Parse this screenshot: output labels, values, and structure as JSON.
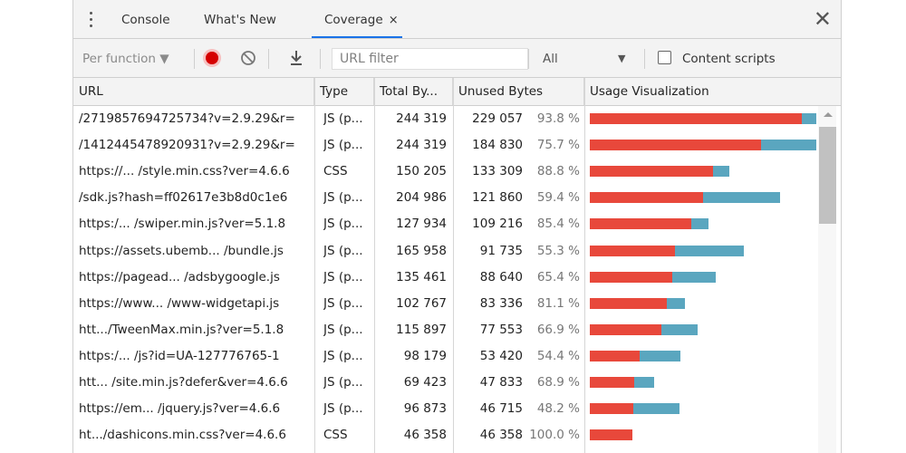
{
  "tabs": [
    {
      "label": "Console"
    },
    {
      "label": "What's New"
    },
    {
      "label": "Coverage",
      "close": "×"
    }
  ],
  "panel_close": "✕",
  "toolbar": {
    "granularity": "Per function ▼",
    "url_filter_placeholder": "URL filter",
    "type_filter": "All",
    "type_filter_arrow": "▼",
    "content_scripts_label": "Content scripts"
  },
  "columns": {
    "url": "URL",
    "type": "Type",
    "total": "Total By...",
    "unused": "Unused Bytes",
    "viz": "Usage Visualization"
  },
  "rows": [
    {
      "url": "/2719857694725734?v=2.9.29&r=",
      "type": "JS (p...",
      "total": "244 319",
      "unused": "229 057",
      "pct": "93.8 %",
      "used_frac": 0.0625,
      "unused_frac": 0.9375
    },
    {
      "url": "/1412445478920931?v=2.9.29&r=",
      "type": "JS (p...",
      "total": "244 319",
      "unused": "184 830",
      "pct": "75.7 %",
      "used_frac": 0.243,
      "unused_frac": 0.757
    },
    {
      "url": "https://... /style.min.css?ver=4.6.6",
      "type": "CSS",
      "total": "150 205",
      "unused": "133 309",
      "pct": "88.8 %",
      "used_frac": 0.112,
      "unused_frac": 0.888
    },
    {
      "url": "/sdk.js?hash=ff02617e3b8d0c1e6",
      "type": "JS (p...",
      "total": "204 986",
      "unused": "121 860",
      "pct": "59.4 %",
      "used_frac": 0.406,
      "unused_frac": 0.594
    },
    {
      "url": "https:/... /swiper.min.js?ver=5.1.8",
      "type": "JS (p...",
      "total": "127 934",
      "unused": "109 216",
      "pct": "85.4 %",
      "used_frac": 0.146,
      "unused_frac": 0.854
    },
    {
      "url": "https://assets.ubemb... /bundle.js",
      "type": "JS (p...",
      "total": "165 958",
      "unused": "91 735",
      "pct": "55.3 %",
      "used_frac": 0.447,
      "unused_frac": 0.553
    },
    {
      "url": "https://pagead... /adsbygoogle.js",
      "type": "JS (p...",
      "total": "135 461",
      "unused": "88 640",
      "pct": "65.4 %",
      "used_frac": 0.346,
      "unused_frac": 0.654
    },
    {
      "url": "https://www... /www-widgetapi.js",
      "type": "JS (p...",
      "total": "102 767",
      "unused": "83 336",
      "pct": "81.1 %",
      "used_frac": 0.189,
      "unused_frac": 0.811
    },
    {
      "url": "htt.../TweenMax.min.js?ver=5.1.8",
      "type": "JS (p...",
      "total": "115 897",
      "unused": "77 553",
      "pct": "66.9 %",
      "used_frac": 0.331,
      "unused_frac": 0.669
    },
    {
      "url": "https:/... /js?id=UA-127776765-1",
      "type": "JS (p...",
      "total": "98 179",
      "unused": "53 420",
      "pct": "54.4 %",
      "used_frac": 0.456,
      "unused_frac": 0.544
    },
    {
      "url": "htt... /site.min.js?defer&ver=4.6.6",
      "type": "JS (p...",
      "total": "69 423",
      "unused": "47 833",
      "pct": "68.9 %",
      "used_frac": 0.311,
      "unused_frac": 0.689
    },
    {
      "url": "https://em... /jquery.js?ver=4.6.6",
      "type": "JS (p...",
      "total": "96 873",
      "unused": "46 715",
      "pct": "48.2 %",
      "used_frac": 0.518,
      "unused_frac": 0.482
    },
    {
      "url": "ht.../dashicons.min.css?ver=4.6.6",
      "type": "CSS",
      "total": "46 358",
      "unused": "46 358",
      "pct": "100.0 %",
      "used_frac": 0.0,
      "unused_frac": 1.0
    }
  ],
  "colors": {
    "unused_bar": "#e8483b",
    "used_bar": "#5aa6bf",
    "record_active": "#d50000",
    "tab_underline": "#1a73e8"
  },
  "icons": [
    "kebab-menu-icon",
    "record-icon",
    "clear-icon",
    "download-icon",
    "close-icon",
    "checkbox-icon",
    "scroll-up-icon"
  ]
}
